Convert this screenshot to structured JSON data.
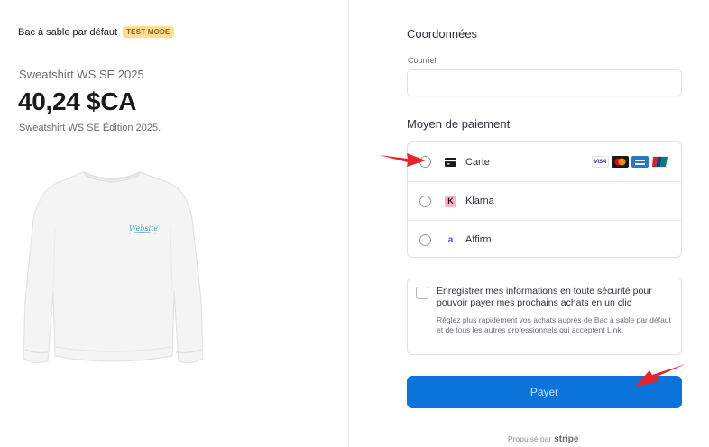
{
  "merchant": {
    "name": "Bac à sable par défaut",
    "badge": "TEST MODE"
  },
  "product": {
    "name": "Sweatshirt WS SE 2025",
    "price": "40,24 $CA",
    "description": "Sweatshirt WS SE Édition 2025.",
    "image_text": "Website"
  },
  "contact": {
    "title": "Coordonnées",
    "email_label": "Courriel",
    "email_value": ""
  },
  "payment": {
    "title": "Moyen de paiement",
    "methods": [
      {
        "label": "Carte"
      },
      {
        "label": "Klarna",
        "icon_letter": "K"
      },
      {
        "label": "Affirm",
        "icon_letter": "a"
      }
    ],
    "card_brands": [
      {
        "name": "VISA",
        "icon": "visa-icon"
      },
      {
        "name": "",
        "icon": "mastercard-icon"
      },
      {
        "name": "",
        "icon": "amex-icon"
      },
      {
        "name": "",
        "icon": "unionpay-icon"
      }
    ]
  },
  "save": {
    "title": "Enregistrer mes informations en toute sécurité pour pouvoir payer mes prochains achats en un clic",
    "description": "Réglez plus rapidement vos achats auprès de Bac à sable par défaut et de tous les autres professionnels qui acceptent Link."
  },
  "pay_button": "Payer",
  "footer": {
    "powered_by": "Propulsé par",
    "brand": "stripe"
  },
  "colors": {
    "accent": "#0a74da",
    "badge_bg": "#ffde92",
    "badge_text": "#a2551b",
    "arrow": "#e8242b",
    "klarna_bg": "#ffb3c7"
  }
}
